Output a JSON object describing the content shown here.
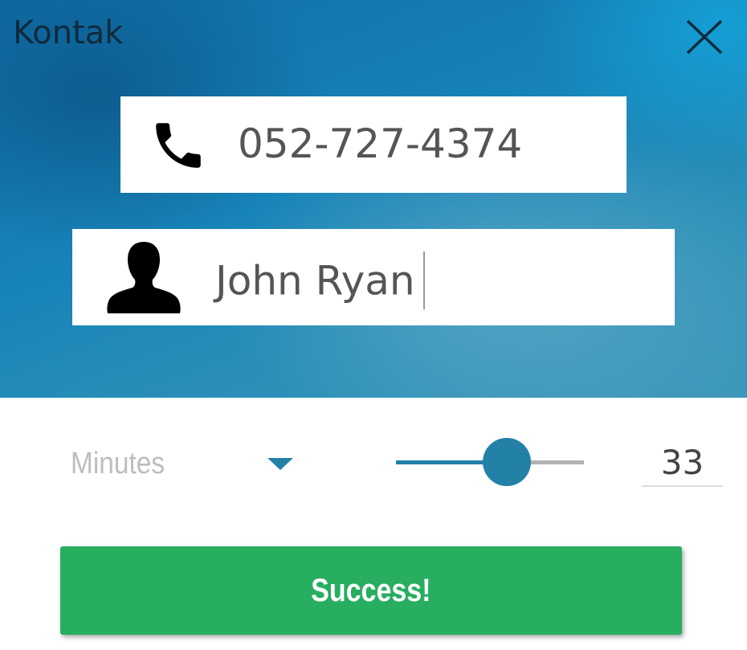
{
  "header": {
    "title": "Kontak",
    "close_icon": "close-icon"
  },
  "phone": {
    "icon": "phone-icon",
    "value": "052-727-4374"
  },
  "name": {
    "icon": "person-icon",
    "value": "John Ryan"
  },
  "duration": {
    "unit_label": "Minutes",
    "dropdown_icon": "triangle-down-icon",
    "slider_fraction": 0.59,
    "value": "33"
  },
  "action": {
    "label": "Success!"
  },
  "colors": {
    "accent": "#2381a8",
    "success": "#27ae60",
    "header_gradient_start": "#0f6ea6",
    "header_gradient_end": "#3c97b9"
  }
}
